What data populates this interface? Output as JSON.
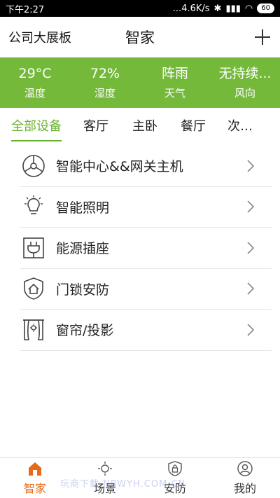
{
  "statusbar": {
    "time": "下午2:27",
    "speed": "...4.6K/s",
    "battery": "60"
  },
  "header": {
    "left_label": "公司大展板",
    "title": "智家"
  },
  "weather": [
    {
      "value": "29°C",
      "label": "温度"
    },
    {
      "value": "72%",
      "label": "湿度"
    },
    {
      "value": "阵雨",
      "label": "天气"
    },
    {
      "value": "无持续...",
      "label": "风向"
    }
  ],
  "tabs": [
    {
      "label": "全部设备"
    },
    {
      "label": "客厅"
    },
    {
      "label": "主卧"
    },
    {
      "label": "餐厅"
    },
    {
      "label": "次…"
    }
  ],
  "devices": [
    {
      "label": "智能中心&&网关主机",
      "icon": "hub-icon"
    },
    {
      "label": "智能照明",
      "icon": "bulb-icon"
    },
    {
      "label": "能源插座",
      "icon": "plug-icon"
    },
    {
      "label": "门锁安防",
      "icon": "shield-home-icon"
    },
    {
      "label": "窗帘/投影",
      "icon": "curtain-icon"
    }
  ],
  "bottomnav": [
    {
      "label": "智家",
      "icon": "home-icon"
    },
    {
      "label": "场景",
      "icon": "scene-icon"
    },
    {
      "label": "安防",
      "icon": "security-icon"
    },
    {
      "label": "我的",
      "icon": "profile-icon"
    }
  ],
  "watermark": "玩商下载 NBWYH.COM.CN",
  "colors": {
    "accent_green": "#74b93a",
    "tab_active": "#6bb22e",
    "nav_active": "#e76a1a"
  }
}
